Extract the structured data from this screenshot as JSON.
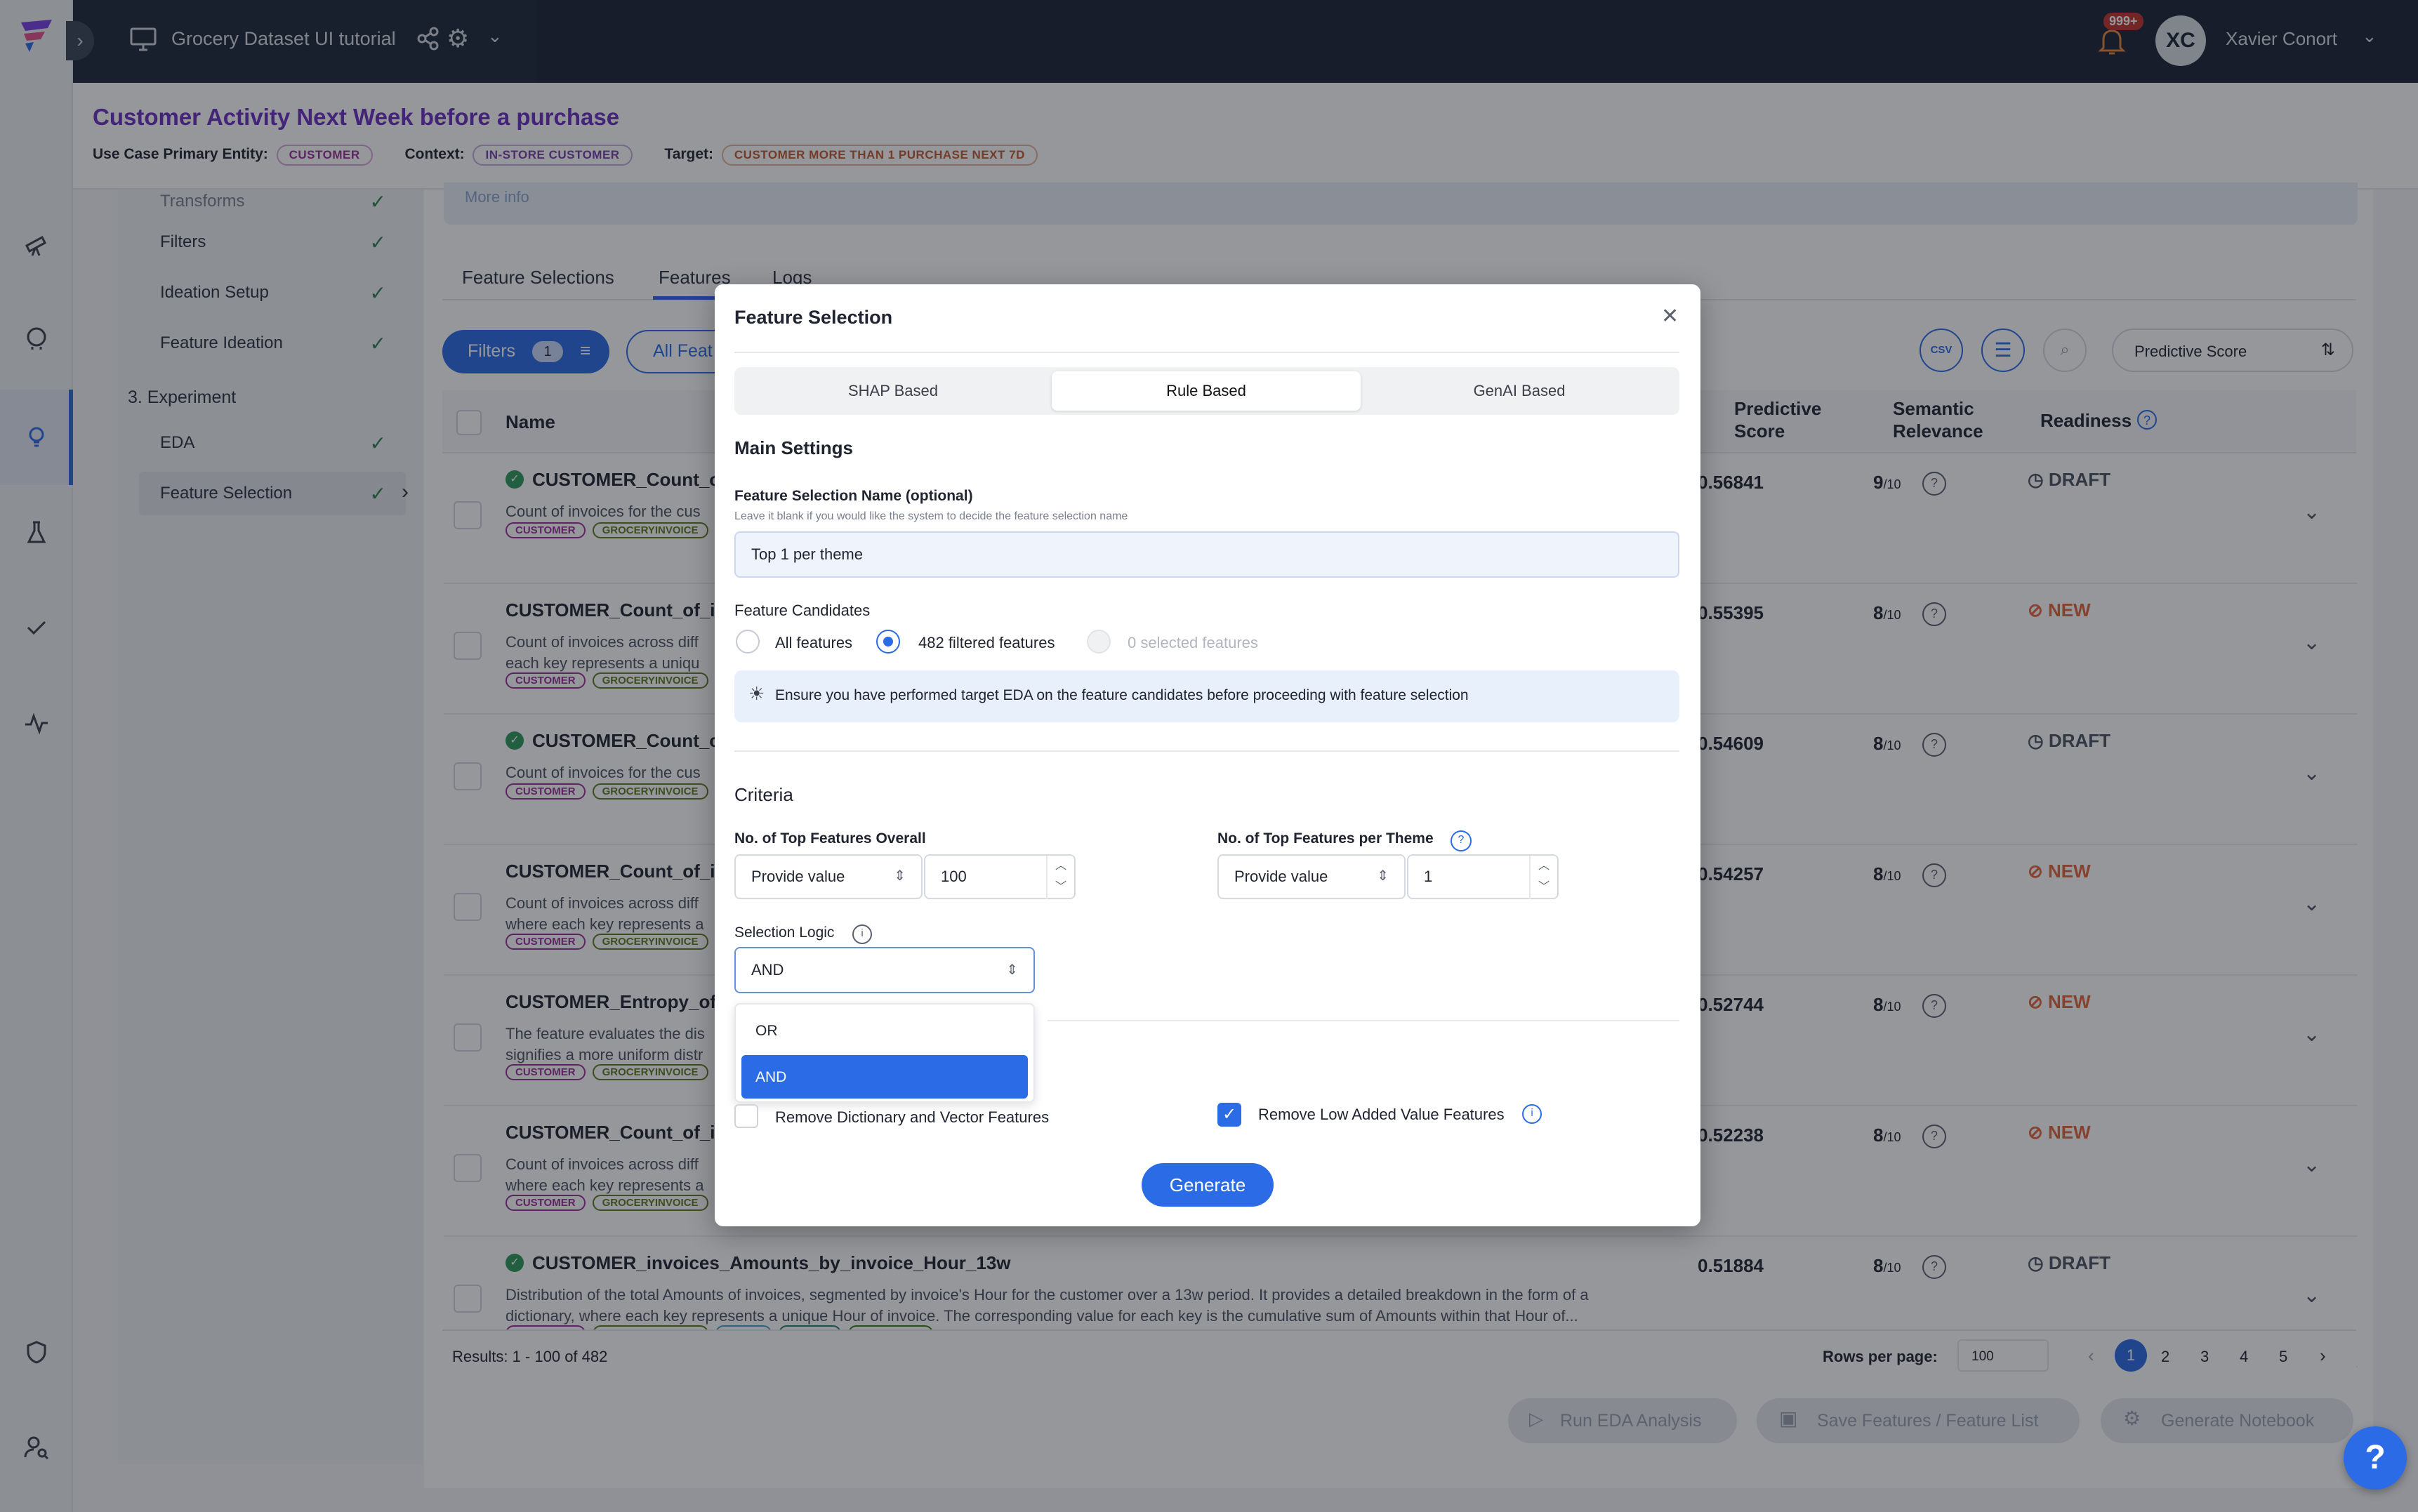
{
  "app": {
    "project_title": "Grocery Dataset UI tutorial",
    "notification_count": "999+",
    "user_initials": "XC",
    "user_name": "Xavier Conort"
  },
  "header": {
    "title": "Customer Activity Next Week before a purchase",
    "entity_label": "Use Case Primary Entity:",
    "entity": "CUSTOMER",
    "context_label": "Context:",
    "context": "IN-STORE CUSTOMER",
    "target_label": "Target:",
    "target": "CUSTOMER MORE THAN 1 PURCHASE NEXT 7D"
  },
  "steps": {
    "items": [
      "Transforms",
      "Filters",
      "Ideation Setup",
      "Feature Ideation"
    ],
    "experiment_label": "3. Experiment",
    "experiment_items": [
      "EDA",
      "Feature Selection"
    ]
  },
  "main": {
    "more_info": "More info",
    "tabs": [
      "Feature Selections",
      "Features",
      "Logs"
    ],
    "filters_label": "Filters",
    "filters_count": "1",
    "all_features_label": "All Feat",
    "sort_label": "Predictive Score",
    "columns": {
      "name": "Name",
      "predictive": "Predictive Score",
      "semantic": "Semantic Relevance",
      "readiness": "Readiness"
    },
    "rows": [
      {
        "name": "CUSTOMER_Count_of",
        "desc1": "Count of invoices for the cus",
        "desc2": "",
        "score": "0.56841",
        "relevance": "9",
        "readiness": "DRAFT",
        "icon": true
      },
      {
        "name": "CUSTOMER_Count_of_in",
        "desc1": "Count of invoices across diff",
        "desc2": "each key represents a uniqu",
        "score": "0.55395",
        "relevance": "8",
        "readiness": "NEW",
        "icon": false
      },
      {
        "name": "CUSTOMER_Count_of",
        "desc1": "Count of invoices for the cus",
        "desc2": "",
        "score": "0.54609",
        "relevance": "8",
        "readiness": "DRAFT",
        "icon": true
      },
      {
        "name": "CUSTOMER_Count_of_in",
        "desc1": "Count of invoices across diff",
        "desc2": "where each key represents a",
        "score": "0.54257",
        "relevance": "8",
        "readiness": "NEW",
        "icon": false
      },
      {
        "name": "CUSTOMER_Entropy_of_",
        "desc1": "The feature evaluates the dis",
        "desc2": "signifies a more uniform distr",
        "score": "0.52744",
        "relevance": "8",
        "readiness": "NEW",
        "icon": false
      },
      {
        "name": "CUSTOMER_Count_of_in",
        "desc1": "Count of invoices across diff",
        "desc2": "where each key represents a",
        "score": "0.52238",
        "relevance": "8",
        "readiness": "NEW",
        "icon": false
      },
      {
        "name": "CUSTOMER_invoices_Amounts_by_invoice_Hour_13w",
        "desc1": "Distribution of the total Amounts of invoices, segmented by invoice's Hour for the customer over a 13w period. It provides a detailed breakdown in the form of a",
        "desc2": "dictionary, where each key represents a unique Hour of invoice. The corresponding value for each key is the cumulative sum of Amounts within that Hour of...",
        "score": "0.51884",
        "relevance": "8",
        "readiness": "DRAFT",
        "icon": true
      }
    ],
    "tags": {
      "customer": "CUSTOMER",
      "grocery": "GROCERYINVOICE",
      "timing": "TIMING",
      "object": "OBJECT",
      "dictionary": "DICTIONARY"
    },
    "out_of": "/10",
    "results": "Results: 1 - 100 of 482",
    "rows_per_page_label": "Rows per page:",
    "rows_per_page": "100",
    "pages": [
      "1",
      "2",
      "3",
      "4",
      "5"
    ],
    "run_eda": "Run EDA Analysis",
    "save_features": "Save Features / Feature List",
    "generate_notebook": "Generate Notebook"
  },
  "modal": {
    "title": "Feature Selection",
    "modes": [
      "SHAP Based",
      "Rule Based",
      "GenAI Based"
    ],
    "main_settings": "Main Settings",
    "name_label": "Feature Selection Name (optional)",
    "name_help": "Leave it blank if you would like the system to decide the feature selection name",
    "name_value": "Top 1 per theme",
    "candidates_label": "Feature Candidates",
    "cand_all": "All features",
    "cand_filtered": "482 filtered features",
    "cand_selected": "0 selected features",
    "info": "Ensure you have performed target EDA on the feature candidates before proceeding with feature selection",
    "criteria": "Criteria",
    "top_overall_label": "No. of Top Features Overall",
    "top_overall_mode": "Provide value",
    "top_overall_value": "100",
    "top_theme_label": "No. of Top Features per Theme",
    "top_theme_mode": "Provide value",
    "top_theme_value": "1",
    "logic_label": "Selection Logic",
    "logic_value": "AND",
    "logic_options": [
      "OR",
      "AND"
    ],
    "remove_dict": "Remove Dictionary and Vector Features",
    "remove_low": "Remove Low Added Value Features",
    "generate": "Generate"
  }
}
